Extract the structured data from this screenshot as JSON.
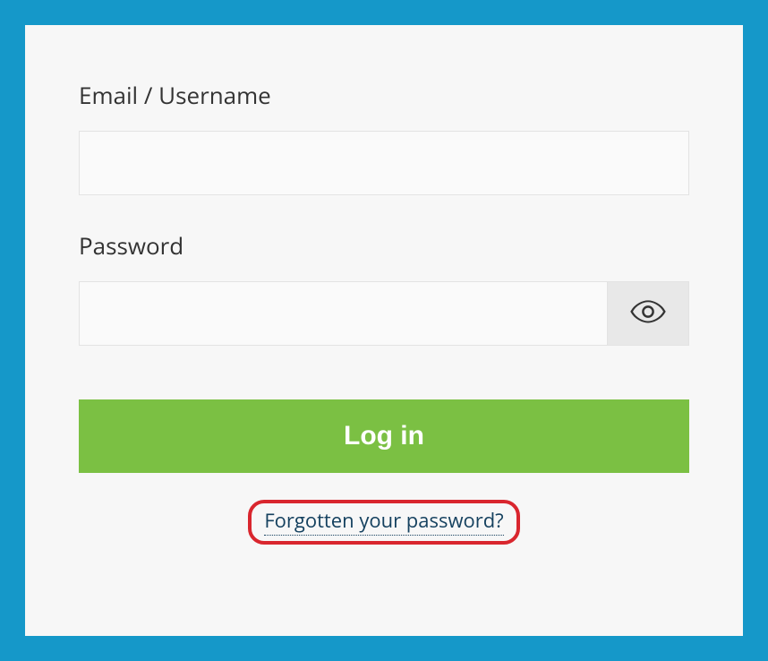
{
  "form": {
    "username_label": "Email / Username",
    "username_value": "",
    "password_label": "Password",
    "password_value": "",
    "login_button": "Log in",
    "forgot_link": "Forgotten your password?"
  }
}
